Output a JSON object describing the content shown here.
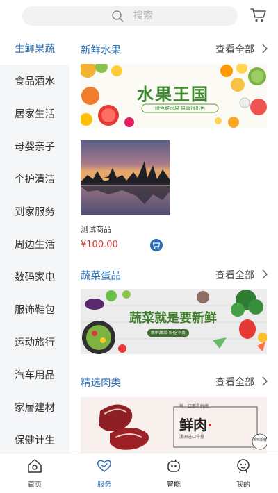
{
  "search": {
    "placeholder": "搜索",
    "icon": "search-icon"
  },
  "header": {
    "cart_icon": "cart-icon"
  },
  "sidebar": {
    "items": [
      {
        "label": "生鲜果蔬",
        "active": true
      },
      {
        "label": "食品酒水"
      },
      {
        "label": "居家生活"
      },
      {
        "label": "母婴亲子"
      },
      {
        "label": "个护清洁"
      },
      {
        "label": "到家服务"
      },
      {
        "label": "周边生活"
      },
      {
        "label": "数码家电"
      },
      {
        "label": "服饰鞋包"
      },
      {
        "label": "运动旅行"
      },
      {
        "label": "汽车用品"
      },
      {
        "label": "家居建材"
      },
      {
        "label": "保健计生"
      }
    ]
  },
  "sections": [
    {
      "title": "新鲜水果",
      "more": "查看全部",
      "banner": {
        "headline": "水果王国",
        "tagline": "绿色鲜水果 果真很出色"
      }
    },
    {
      "title": "蔬菜蛋品",
      "more": "查看全部",
      "banner": {
        "headline": "蔬菜就是要新鲜",
        "tagline": "新鲜蔬菜 好吃不贵"
      }
    },
    {
      "title": "精选肉类",
      "more": "查看全部",
      "banner": {
        "headline": "鲜肉",
        "tagline": "澳洲进口牛排",
        "top_text": "每一口都是鲜嫩",
        "badge": "美味新鲜"
      }
    }
  ],
  "product": {
    "name": "测试商品",
    "price": "¥100.00"
  },
  "bottom_nav": {
    "items": [
      {
        "label": "首页",
        "icon": "home-icon"
      },
      {
        "label": "服务",
        "icon": "heart-icon",
        "active": true
      },
      {
        "label": "智能",
        "icon": "robot-icon"
      },
      {
        "label": "我的",
        "icon": "user-icon"
      }
    ]
  },
  "colors": {
    "accent": "#2a6fb5",
    "price": "#d9352b",
    "sidebar_bg": "#f4f6f8"
  }
}
